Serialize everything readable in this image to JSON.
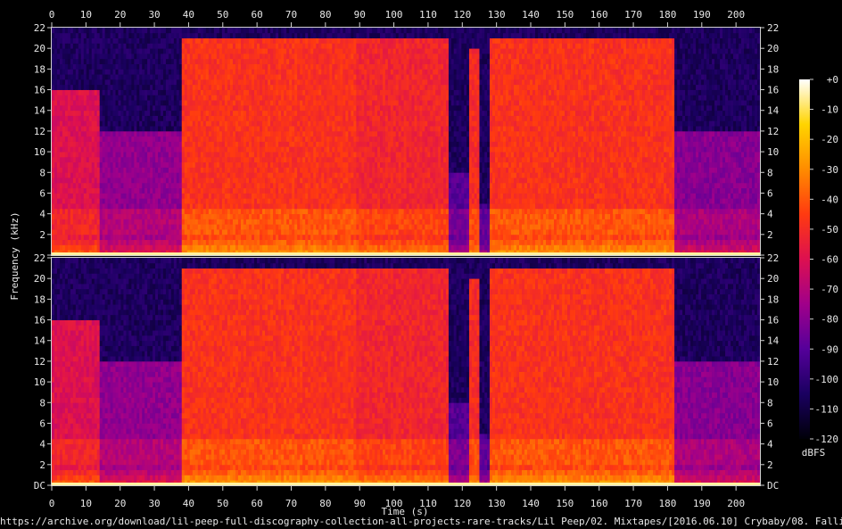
{
  "chart_data": {
    "type": "heatmap",
    "subtype": "spectrogram",
    "channels": 2,
    "xlabel": "Time (s)",
    "ylabel": "Frequency (kHz)",
    "x_ticks": [
      "0",
      "10",
      "20",
      "30",
      "40",
      "50",
      "60",
      "70",
      "80",
      "90",
      "100",
      "110",
      "120",
      "130",
      "140",
      "150",
      "160",
      "170",
      "180",
      "190",
      "200"
    ],
    "xlim": [
      0,
      207
    ],
    "y_ticks": [
      "DC",
      "2",
      "4",
      "6",
      "8",
      "10",
      "12",
      "14",
      "16",
      "18",
      "20",
      "22"
    ],
    "ylim": [
      0,
      22
    ],
    "colorbar": {
      "label": "dBFS",
      "ticks": [
        "+0",
        "-10",
        "-20",
        "-30",
        "-40",
        "-50",
        "-60",
        "-70",
        "-80",
        "-90",
        "-100",
        "-110",
        "-120"
      ],
      "range": [
        -120,
        0
      ],
      "colors": [
        "#000008",
        "#1a0060",
        "#55009a",
        "#a0008a",
        "#dd1050",
        "#ff3a10",
        "#ff8c00",
        "#ffd400",
        "#ffffff"
      ]
    },
    "segments": [
      {
        "start": 0,
        "end": 14,
        "level": -60,
        "cutoff_khz": 16
      },
      {
        "start": 14,
        "end": 38,
        "level": -78,
        "cutoff_khz": 12
      },
      {
        "start": 38,
        "end": 89,
        "level": -48,
        "cutoff_khz": 21
      },
      {
        "start": 89,
        "end": 116,
        "level": -52,
        "cutoff_khz": 21
      },
      {
        "start": 116,
        "end": 122,
        "level": -90,
        "cutoff_khz": 8
      },
      {
        "start": 122,
        "end": 125,
        "level": -50,
        "cutoff_khz": 20
      },
      {
        "start": 125,
        "end": 128,
        "level": -95,
        "cutoff_khz": 5
      },
      {
        "start": 128,
        "end": 182,
        "level": -48,
        "cutoff_khz": 21
      },
      {
        "start": 182,
        "end": 207,
        "level": -80,
        "cutoff_khz": 12
      }
    ]
  },
  "source_path": "https://archive.org/download/lil-peep-full-discography-collection-all-projects-rare-tracks/Lil Peep/02. Mixtapes/[2016.06.10] Crybaby/08. Falling 4 Me.mp3"
}
